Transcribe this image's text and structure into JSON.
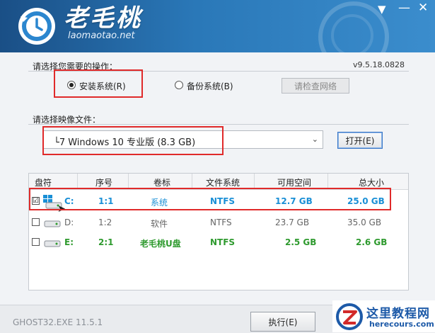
{
  "app": {
    "brand": "老毛桃",
    "site": "laomaotao.net",
    "version": "v9.5.18.0828"
  },
  "operation": {
    "title": "请选择您需要的操作：",
    "install_label": "安装系统(R)",
    "backup_label": "备份系统(B)",
    "network_button": "请检查网络",
    "selected": "install"
  },
  "image": {
    "title": "请选择映像文件：",
    "selected_file": "└7 Windows 10 专业版 (8.3 GB)",
    "open_button": "打开(E)"
  },
  "table": {
    "headers": [
      "盘符",
      "序号",
      "卷标",
      "文件系统",
      "可用空间",
      "总大小"
    ],
    "rows": [
      {
        "checked": "☑",
        "drive": "C:",
        "index": "1:1",
        "label": "系统",
        "fs": "NTFS",
        "free": "12.7 GB",
        "total": "25.0 GB",
        "color": "#1a8fd6"
      },
      {
        "checked": "",
        "drive": "D:",
        "index": "1:2",
        "label": "软件",
        "fs": "NTFS",
        "free": "23.7 GB",
        "total": "35.0 GB",
        "color": "#666666"
      },
      {
        "checked": "",
        "drive": "E:",
        "index": "2:1",
        "label": "老毛桃U盘",
        "fs": "NTFS",
        "free": "2.5 GB",
        "total": "2.6 GB",
        "color": "#2e9a2e"
      }
    ]
  },
  "footer": {
    "ghost_version": "GHOST32.EXE 11.5.1",
    "execute_button": "执行(E)"
  },
  "watermark": {
    "title": "这里教程网",
    "url": "herecours.com"
  },
  "colors": {
    "header": "#2a78b8",
    "highlight_red": "#e02a2a",
    "system_blue": "#1a8fd6",
    "usb_green": "#2e9a2e"
  }
}
